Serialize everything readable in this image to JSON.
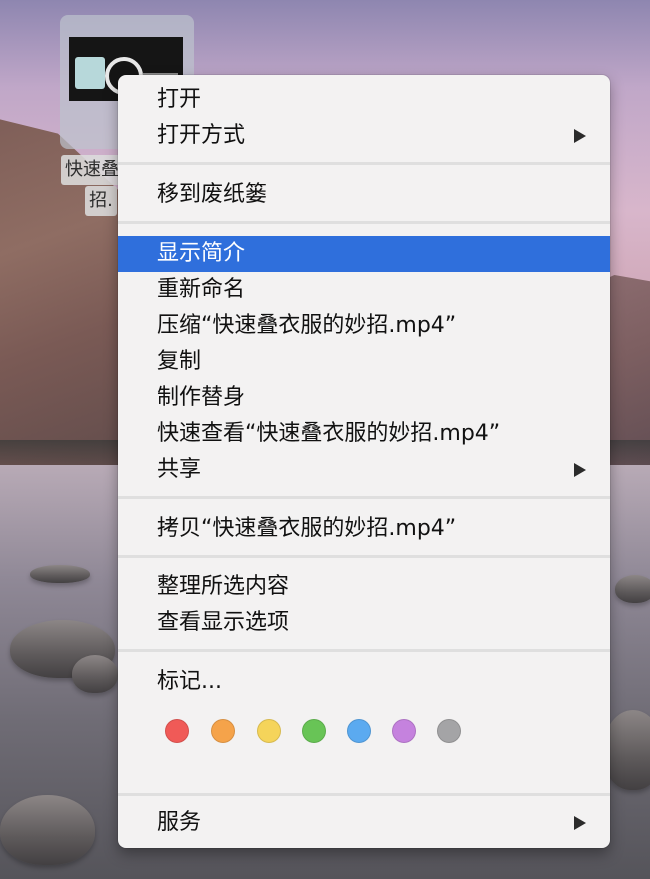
{
  "file": {
    "label_line1": "快速叠衣",
    "label_line2": "招.",
    "icon": "video-file-icon"
  },
  "menu": {
    "open": "打开",
    "open_with": "打开方式",
    "move_to_trash": "移到废纸篓",
    "get_info": "显示简介",
    "rename": "重新命名",
    "compress": "压缩“快速叠衣服的妙招.mp4”",
    "duplicate": "复制",
    "make_alias": "制作替身",
    "quick_look": "快速查看“快速叠衣服的妙招.mp4”",
    "share": "共享",
    "copy": "拷贝“快速叠衣服的妙招.mp4”",
    "clean_up_selection": "整理所选内容",
    "show_view_options": "查看显示选项",
    "tags": "标记...",
    "services": "服务"
  },
  "tag_colors": {
    "red": "#f05a57",
    "orange": "#f5a34a",
    "yellow": "#f5d45a",
    "green": "#68c456",
    "blue": "#5baaf0",
    "purple": "#c582de",
    "gray": "#a4a4a6"
  },
  "theme": {
    "highlight": "#2f6fdc"
  },
  "icons": {
    "submenu": "chevron-right-icon"
  }
}
